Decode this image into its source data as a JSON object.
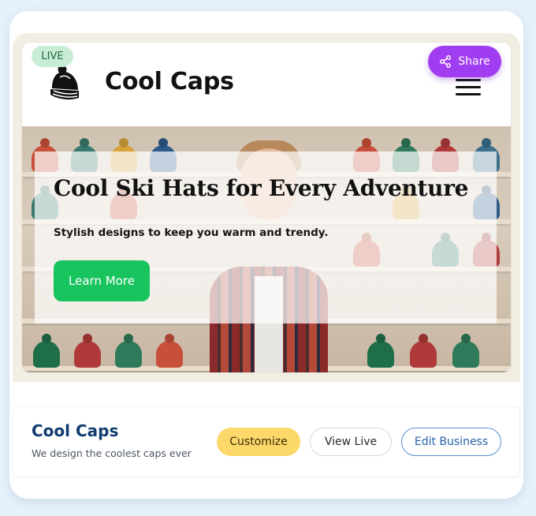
{
  "badge": {
    "live_label": "LIVE"
  },
  "share": {
    "label": "Share"
  },
  "site": {
    "brand_name": "Cool Caps",
    "hero": {
      "title": "Cool Ski Hats for Every Adventure",
      "subtitle": "Stylish designs to keep you warm and trendy.",
      "cta_label": "Learn More"
    }
  },
  "business": {
    "name": "Cool Caps",
    "tagline": "We design the coolest caps ever"
  },
  "actions": {
    "customize_label": "Customize",
    "view_live_label": "View Live",
    "edit_business_label": "Edit Business"
  },
  "colors": {
    "page_bg": "#e6f1fb",
    "live_badge_bg": "#c9ecd6",
    "share_bg": "#a13df0",
    "cta_green": "#18c45e",
    "business_name": "#0f3b6e",
    "customize_bg": "#fcd86a",
    "edit_border": "#5a8fd1"
  }
}
